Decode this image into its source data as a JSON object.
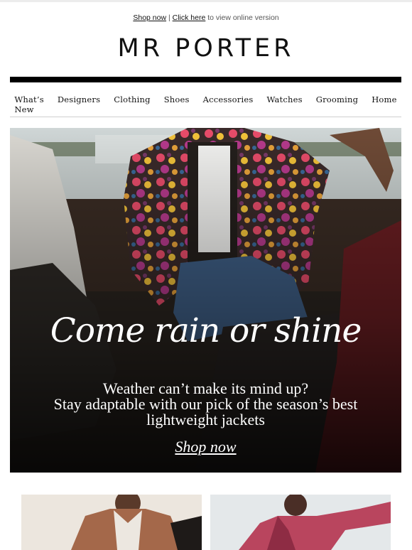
{
  "preheader": {
    "shop_now": "Shop now",
    "separator": "|",
    "click_here": "Click here",
    "suffix": "to view online version"
  },
  "brand": {
    "logo": "MR PORTER"
  },
  "nav": {
    "items": [
      "What’s New",
      "Designers",
      "Clothing",
      "Shoes",
      "Accessories",
      "Watches",
      "Grooming",
      "Home"
    ]
  },
  "hero": {
    "script_title": "Come rain or shine",
    "copy_line1": "Weather can’t make its mind up?",
    "copy_line2": "Stay adaptable with our pick of the season’s best",
    "copy_line3": "lightweight jackets",
    "cta": "Shop now",
    "image_alt": "photo-man-in-floral-jacket-on-boat"
  },
  "tiles": [
    {
      "name": "tile-brown-leather-jacket"
    },
    {
      "name": "tile-pink-dyed-jacket"
    }
  ],
  "colors": {
    "text": "#111111",
    "muted": "#555555",
    "rule": "#000000",
    "divider": "#cfcfcf"
  }
}
